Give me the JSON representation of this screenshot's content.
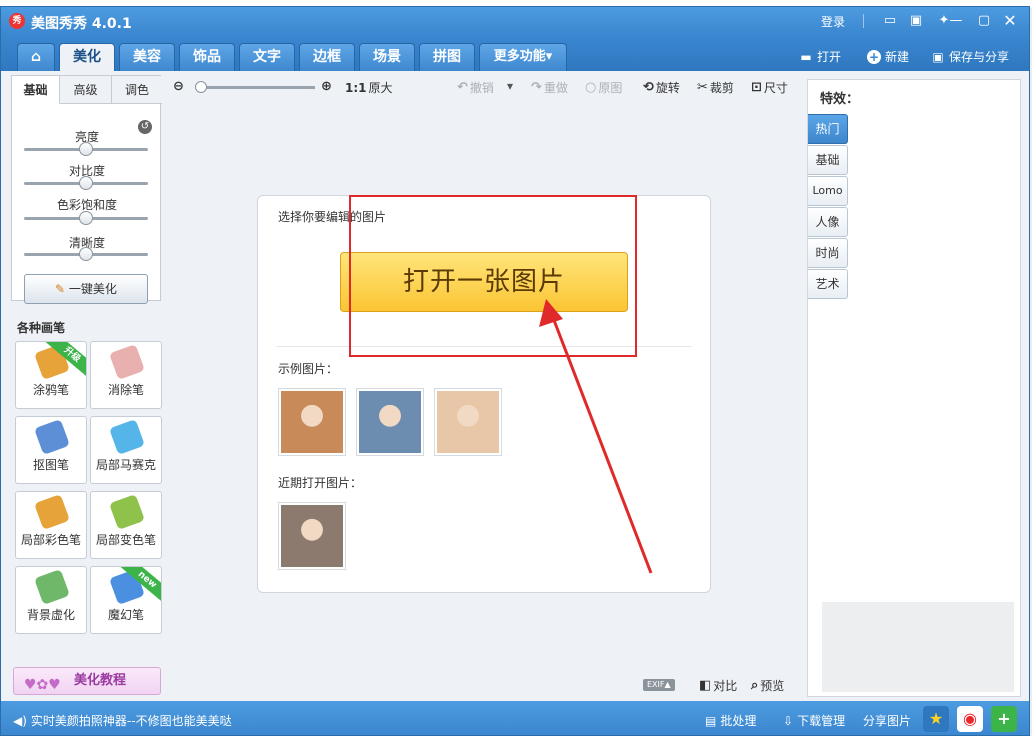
{
  "window": {
    "title": "美图秀秀 4.0.1",
    "logo_text": "秀",
    "login": "登录",
    "controls": [
      "chat-icon",
      "skin-icon",
      "settings-icon",
      "minimize-icon",
      "maximize-icon",
      "close-icon"
    ]
  },
  "nav": {
    "tabs": [
      {
        "label": "⌂",
        "name": "home"
      },
      {
        "label": "美化",
        "name": "beautify"
      },
      {
        "label": "美容",
        "name": "cosmetics"
      },
      {
        "label": "饰品",
        "name": "accessories"
      },
      {
        "label": "文字",
        "name": "text"
      },
      {
        "label": "边框",
        "name": "frame"
      },
      {
        "label": "场景",
        "name": "scene"
      },
      {
        "label": "拼图",
        "name": "collage"
      },
      {
        "label": "更多功能▾",
        "name": "more"
      }
    ],
    "active": "beautify",
    "open_label": "打开",
    "new_label": "新建",
    "save_label": "保存与分享"
  },
  "left": {
    "subtabs": [
      "基础",
      "高级",
      "调色"
    ],
    "sliders": [
      {
        "label": "亮度",
        "value": 0.5
      },
      {
        "label": "对比度",
        "value": 0.5
      },
      {
        "label": "色彩饱和度",
        "value": 0.5
      },
      {
        "label": "清晰度",
        "value": 0.5
      }
    ],
    "one_click": "一键美化",
    "brush_title": "各种画笔",
    "brushes": [
      {
        "label": "涂鸦笔",
        "badge": "升级",
        "badge_color": "#3cb44a",
        "icon": "paintbrush-icon",
        "color": "#e6a33a"
      },
      {
        "label": "消除笔",
        "badge": "",
        "icon": "eraser-icon",
        "color": "#e9b0b0"
      },
      {
        "label": "抠图笔",
        "badge": "",
        "icon": "cutout-pen-icon",
        "color": "#5c8fd6"
      },
      {
        "label": "局部马赛克",
        "badge": "",
        "icon": "mosaic-icon",
        "color": "#55b4e8"
      },
      {
        "label": "局部彩色笔",
        "badge": "",
        "icon": "color-brush-icon",
        "color": "#e6a33a"
      },
      {
        "label": "局部变色笔",
        "badge": "",
        "icon": "color-change-icon",
        "color": "#8fc24a"
      },
      {
        "label": "背景虚化",
        "badge": "",
        "icon": "blur-icon",
        "color": "#6fb86a"
      },
      {
        "label": "魔幻笔",
        "badge": "new",
        "badge_color": "#3cb44a",
        "icon": "magic-pen-icon",
        "color": "#4a8fe0"
      }
    ],
    "tutorial": "美化教程"
  },
  "toolbar": {
    "zoom_value": 0,
    "ratio_label": "1:1",
    "original_size": "原大",
    "undo": "撤销",
    "redo": "重做",
    "original": "原图",
    "rotate": "旋转",
    "crop": "裁剪",
    "size": "尺寸"
  },
  "canvas": {
    "choose_label": "选择你要编辑的图片",
    "open_button": "打开一张图片",
    "sample_label": "示例图片：",
    "recent_label": "近期打开图片：",
    "samples": [
      {
        "name": "sample-photo-1",
        "tone": "#c98a5a"
      },
      {
        "name": "sample-photo-2",
        "tone": "#6d8db0"
      },
      {
        "name": "sample-photo-3",
        "tone": "#e8c7a8"
      }
    ],
    "recent": [
      {
        "name": "recent-photo-1",
        "tone": "#8c7a6e"
      }
    ]
  },
  "effects": {
    "title": "特效：",
    "tabs": [
      "热门",
      "基础",
      "Lomo",
      "人像",
      "时尚",
      "艺术"
    ],
    "active": "热门"
  },
  "bottom_tools": {
    "exif": "EXIF▲",
    "compare": "对比",
    "preview": "预览"
  },
  "status": {
    "ticker": "实时美颜拍照神器--不修图也能美美哒",
    "batch": "批处理",
    "download": "下载管理",
    "share": "分享图片"
  },
  "colors": {
    "accent": "#3a86cf",
    "highlight": "#e02a2a"
  }
}
